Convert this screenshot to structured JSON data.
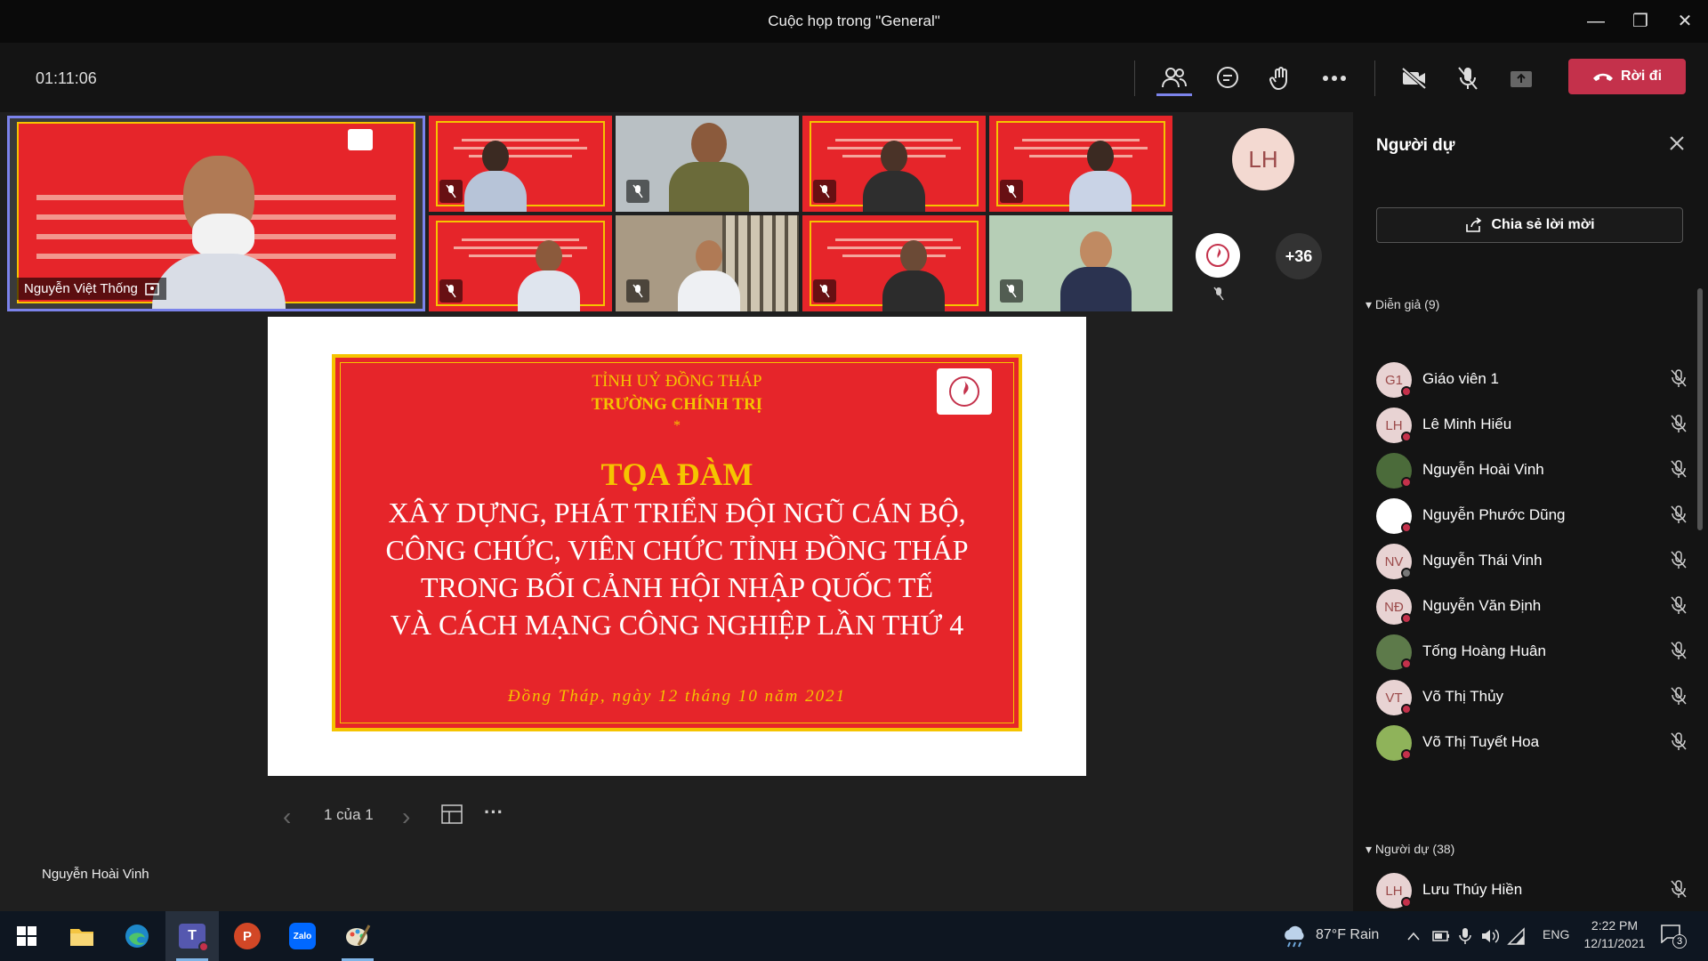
{
  "window": {
    "title": "Cuộc họp trong \"General\"",
    "minimize": "—",
    "restore": "❐",
    "close": "✕"
  },
  "toolbar": {
    "timer": "01:11:06",
    "leave_label": "Rời đi"
  },
  "stage": {
    "featured_name": "Nguyễn Việt Thống",
    "avatar_initials": "LH",
    "more_count": "+36",
    "speaker_label": "Nguyễn Hoài Vinh"
  },
  "slide": {
    "line1": "TỈNH UỶ ĐỒNG THÁP",
    "line2": "TRƯỜNG CHÍNH TRỊ",
    "star": "*",
    "heading": "TỌA ĐÀM",
    "body": [
      "XÂY DỰNG, PHÁT TRIỂN ĐỘI NGŨ CÁN BỘ,",
      "CÔNG CHỨC, VIÊN CHỨC TỈNH ĐỒNG THÁP",
      "TRONG BỐI CẢNH HỘI NHẬP QUỐC TẾ",
      "VÀ CÁCH MẠNG CÔNG NGHIỆP LẦN THỨ 4"
    ],
    "date": "Đồng Tháp, ngày 12 tháng 10 năm 2021"
  },
  "pager": {
    "text": "1 của 1",
    "prev": "‹",
    "next": "›",
    "more": "···"
  },
  "panel": {
    "title": "Người dự",
    "share_label": "Chia sẻ lời mời",
    "presenters_label": "Diễn giả (9)",
    "attendees_label": "Người dự (38)",
    "presenters": [
      {
        "initials": "G1",
        "name": "Giáo viên 1"
      },
      {
        "initials": "LH",
        "name": "Lê Minh Hiếu"
      },
      {
        "initials": "",
        "name": "Nguyễn Hoài Vinh"
      },
      {
        "initials": "",
        "name": "Nguyễn Phước Dũng"
      },
      {
        "initials": "NV",
        "name": "Nguyễn Thái Vinh"
      },
      {
        "initials": "NĐ",
        "name": "Nguyễn Văn Định"
      },
      {
        "initials": "",
        "name": "Tống Hoàng Huân"
      },
      {
        "initials": "VT",
        "name": "Võ Thị Thủy"
      },
      {
        "initials": "",
        "name": "Võ Thị Tuyết Hoa"
      }
    ],
    "attendees": [
      {
        "initials": "LH",
        "name": "Lưu Thúy Hiền"
      }
    ]
  },
  "taskbar": {
    "weather": "87°F  Rain",
    "lang": "ENG",
    "time": "2:22 PM",
    "date": "12/11/2021",
    "notifications": "3",
    "app_icons": [
      "windows-start-icon",
      "file-explorer-icon",
      "edge-icon",
      "teams-icon",
      "powerpoint-icon",
      "zalo-icon",
      "paint-icon"
    ],
    "zalo_text": "Zalo",
    "teams_text": "T",
    "ppt_text": "P"
  },
  "colors": {
    "leave": "#c4314b",
    "accent": "#7b83eb",
    "banner": "#e6252a",
    "banner_text": "#f5c400"
  }
}
